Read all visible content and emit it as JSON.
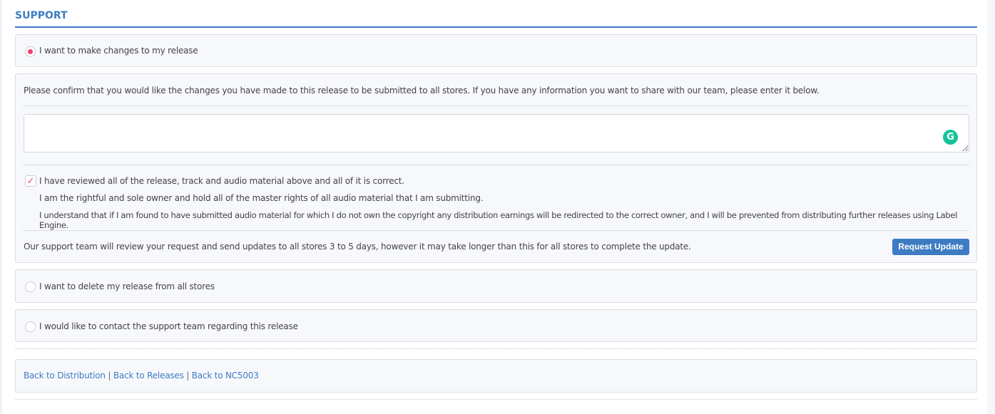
{
  "title": "SUPPORT",
  "options": [
    {
      "label": "I want to make changes to my release",
      "selected": true
    },
    {
      "label": "I want to delete my release from all stores",
      "selected": false
    },
    {
      "label": "I would like to contact the support team regarding this release",
      "selected": false
    }
  ],
  "changes": {
    "intro": "Please confirm that you would like the changes you have made to this release to be submitted to all stores. If you have any information you want to share with our team, please enter it below.",
    "message_value": "",
    "grammarly_icon": "G",
    "confirm_checked": true,
    "confirm_lines": [
      "I have reviewed all of the release, track and audio material above and all of it is correct.",
      "I am the rightful and sole owner and hold all of the master rights of all audio material that I am submitting.",
      "I understand that if I am found to have submitted audio material for which I do not own the copyright any distribution earnings will be redirected to the correct owner, and I will be prevented from distributing further releases using Label Engine."
    ],
    "notice": "Our support team will review your request and send updates to all stores 3 to 5 days, however it may take longer than this for all stores to complete the update.",
    "button": "Request Update"
  },
  "links": [
    "Back to Distribution",
    "Back to Releases",
    "Back to NC5003"
  ],
  "separator": "|",
  "colors": {
    "accent": "#3d7cc2",
    "radio": "#ee3f74",
    "grammarly": "#15c39a"
  }
}
